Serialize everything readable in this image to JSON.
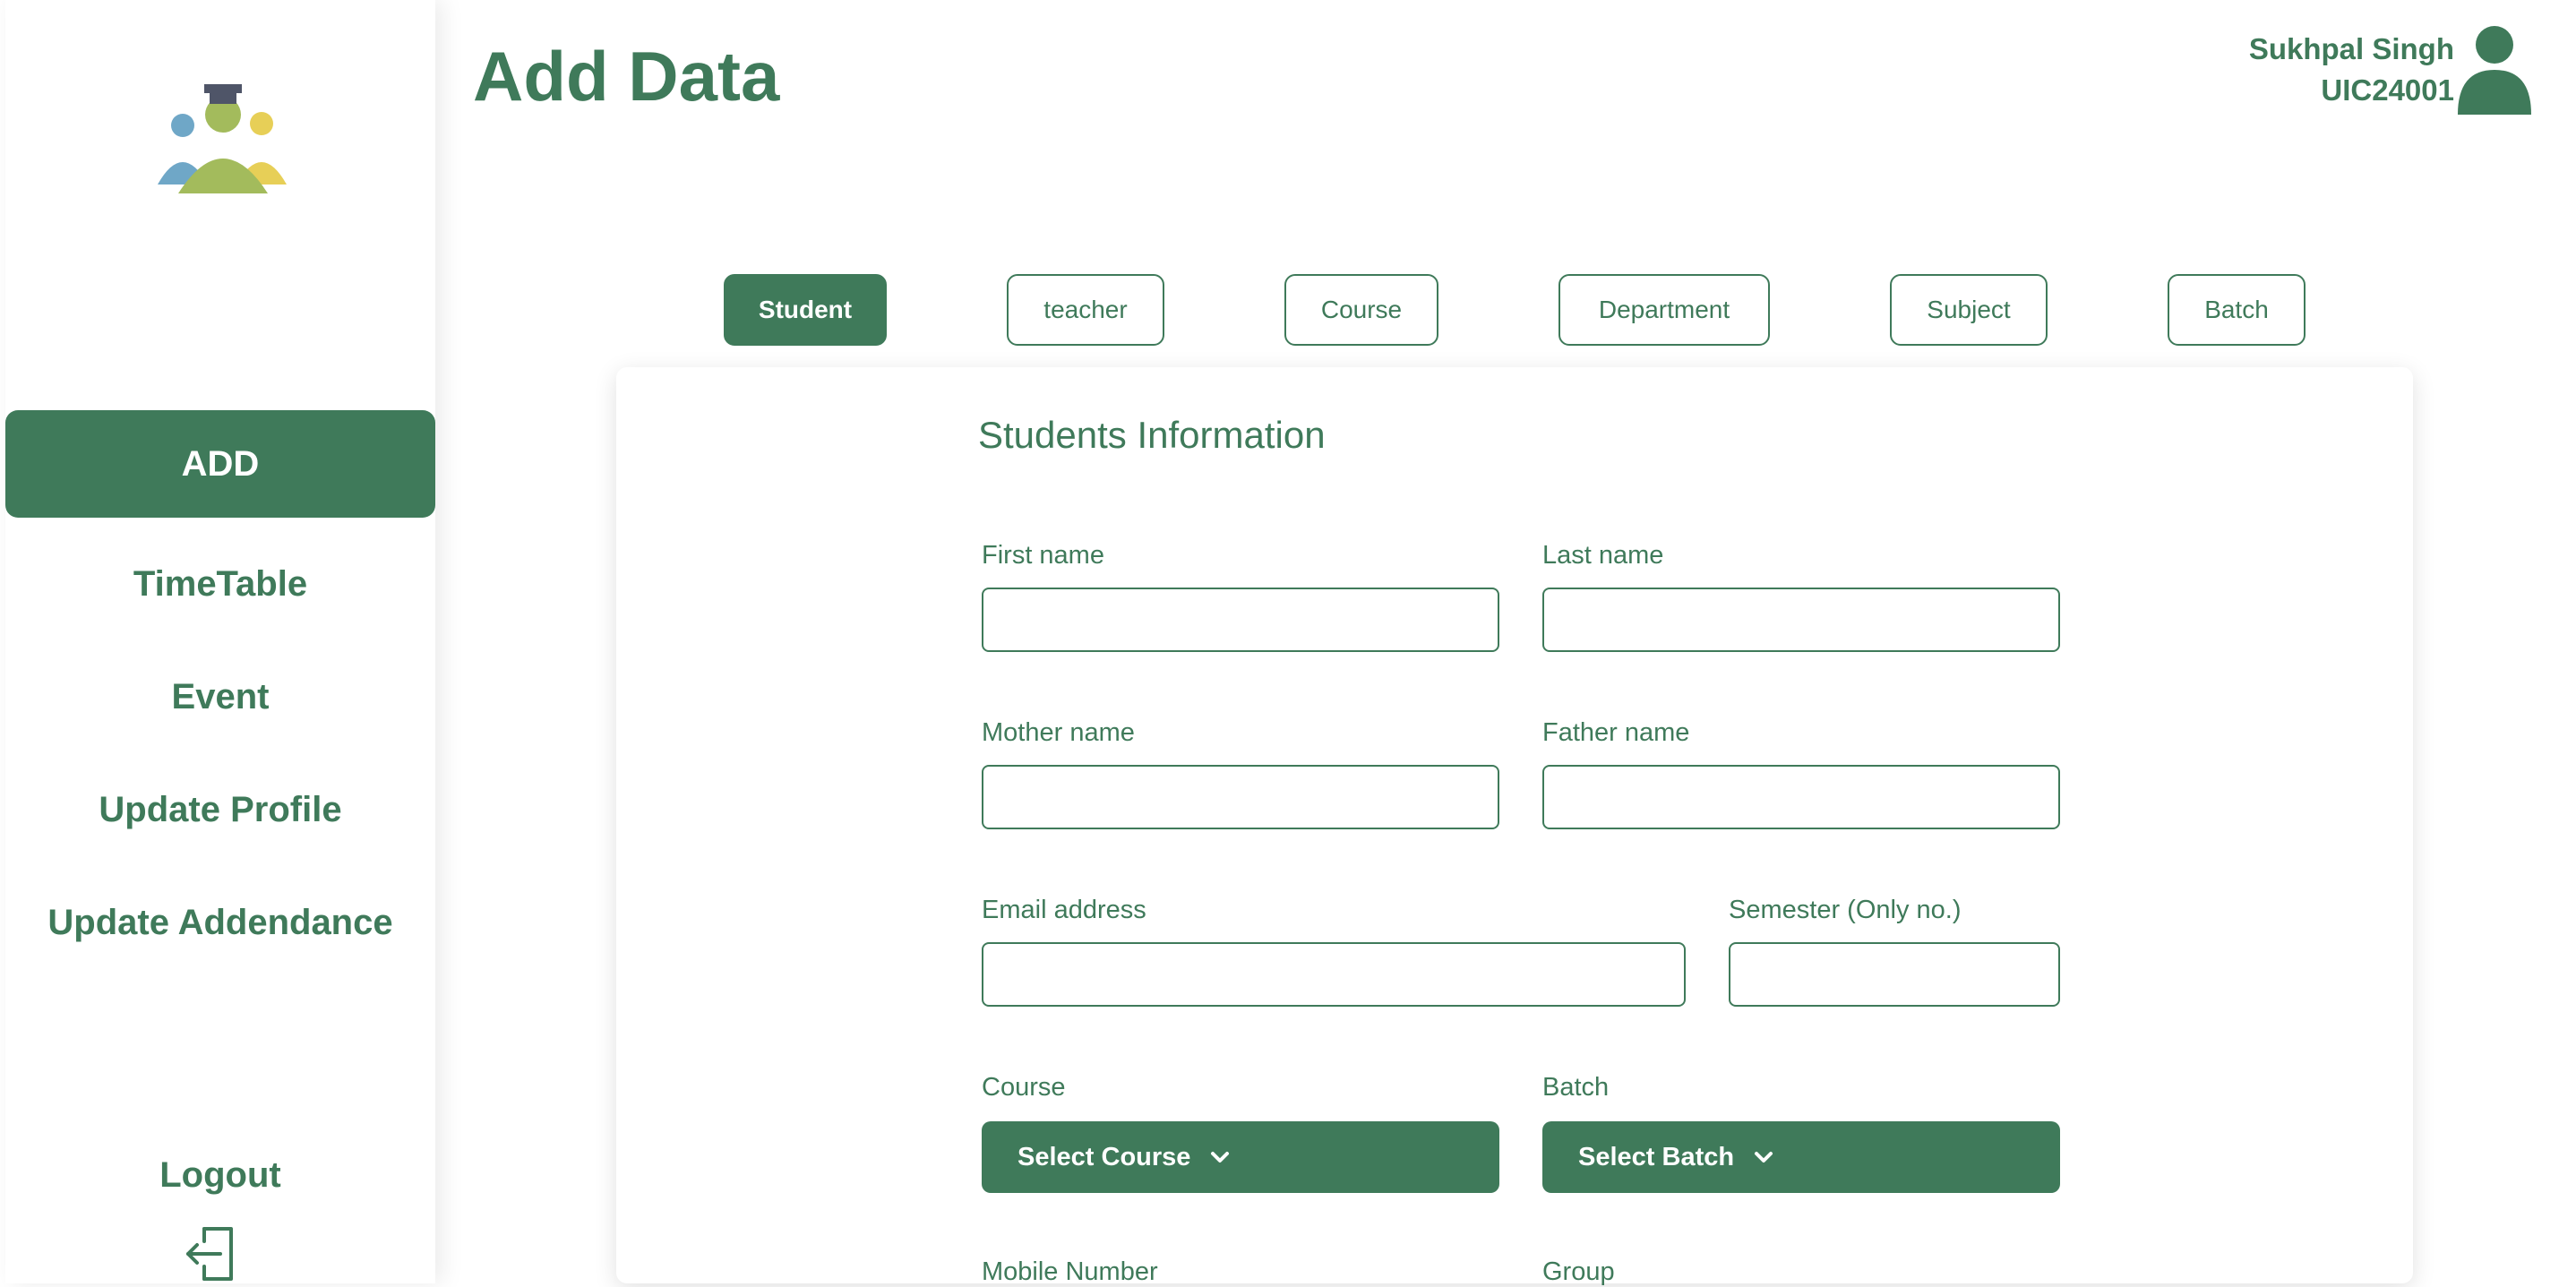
{
  "app": {
    "page_title": "Add Data"
  },
  "user": {
    "name": "Sukhpal Singh",
    "id": "UIC24001"
  },
  "sidebar": {
    "items": [
      {
        "label": "ADD",
        "active": true
      },
      {
        "label": "TimeTable",
        "active": false
      },
      {
        "label": "Event",
        "active": false
      },
      {
        "label": "Update Profile",
        "active": false
      },
      {
        "label": "Update Addendance",
        "active": false
      }
    ],
    "logout_label": "Logout"
  },
  "tabs": [
    {
      "label": "Student",
      "active": true
    },
    {
      "label": "teacher",
      "active": false
    },
    {
      "label": "Course",
      "active": false
    },
    {
      "label": "Department",
      "active": false
    },
    {
      "label": "Subject",
      "active": false
    },
    {
      "label": "Batch",
      "active": false
    }
  ],
  "form": {
    "title": "Students Information",
    "first_name": {
      "label": "First name",
      "value": ""
    },
    "last_name": {
      "label": "Last name",
      "value": ""
    },
    "mother_name": {
      "label": "Mother name",
      "value": ""
    },
    "father_name": {
      "label": "Father name",
      "value": ""
    },
    "email": {
      "label": "Email address",
      "value": ""
    },
    "semester": {
      "label": "Semester (Only no.)",
      "value": ""
    },
    "course": {
      "label": "Course",
      "button": "Select Course"
    },
    "batch": {
      "label": "Batch",
      "button": "Select Batch"
    },
    "mobile": {
      "label": "Mobile Number"
    },
    "group": {
      "label": "Group"
    }
  },
  "colors": {
    "primary": "#3f7a5a",
    "background": "#ffffff"
  },
  "icons": [
    "students-logo-icon",
    "logout-icon",
    "user-avatar-icon",
    "chevron-down-icon"
  ]
}
